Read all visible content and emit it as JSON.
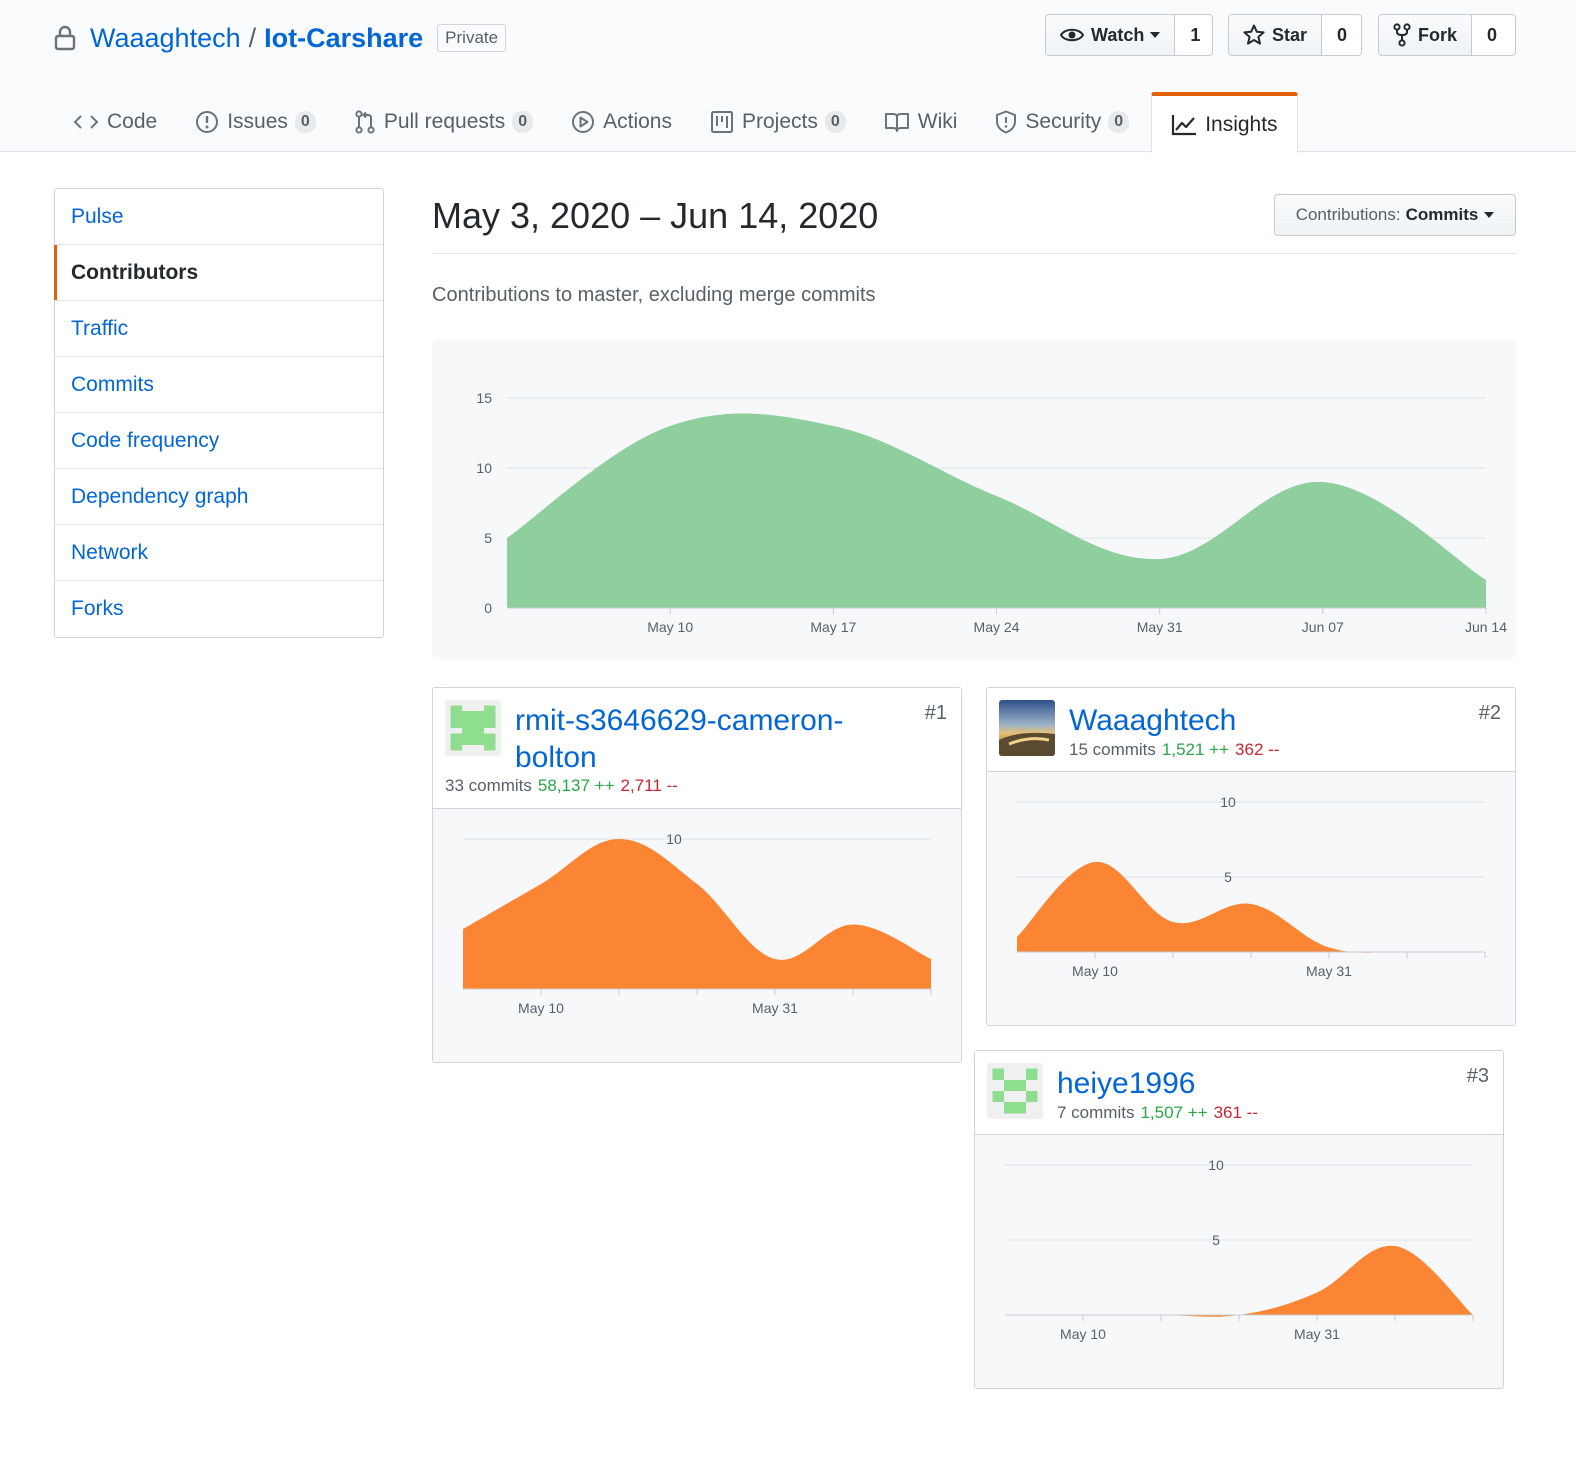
{
  "repo": {
    "owner": "Waaaghtech",
    "separator": "/",
    "name": "Iot-Carshare",
    "visibility": "Private"
  },
  "social": {
    "watch": {
      "label": "Watch",
      "count": "1"
    },
    "star": {
      "label": "Star",
      "count": "0"
    },
    "fork": {
      "label": "Fork",
      "count": "0"
    }
  },
  "nav": [
    {
      "label": "Code",
      "icon": "code-icon",
      "count": null
    },
    {
      "label": "Issues",
      "icon": "issue-icon",
      "count": "0"
    },
    {
      "label": "Pull requests",
      "icon": "pull-request-icon",
      "count": "0"
    },
    {
      "label": "Actions",
      "icon": "play-icon",
      "count": null
    },
    {
      "label": "Projects",
      "icon": "project-icon",
      "count": "0"
    },
    {
      "label": "Wiki",
      "icon": "book-icon",
      "count": null
    },
    {
      "label": "Security",
      "icon": "shield-icon",
      "count": "0"
    },
    {
      "label": "Insights",
      "icon": "graph-icon",
      "count": null,
      "selected": true
    }
  ],
  "sidebar": {
    "items": [
      {
        "label": "Pulse"
      },
      {
        "label": "Contributors",
        "selected": true
      },
      {
        "label": "Traffic"
      },
      {
        "label": "Commits"
      },
      {
        "label": "Code frequency"
      },
      {
        "label": "Dependency graph"
      },
      {
        "label": "Network"
      },
      {
        "label": "Forks"
      }
    ]
  },
  "main": {
    "date_range": "May 3, 2020 – Jun 14, 2020",
    "select_prefix": "Contributions:",
    "select_value": "Commits",
    "subtitle": "Contributions to master, excluding merge commits"
  },
  "colors": {
    "overall": "#8fcf9d",
    "contributor": "#fb8532",
    "link": "#0366d6",
    "accent": "#e36209"
  },
  "chart_data": [
    {
      "id": "overall",
      "type": "area",
      "x": [
        "May 3",
        "May 10",
        "May 17",
        "May 24",
        "May 31",
        "Jun 07",
        "Jun 14"
      ],
      "values": [
        5,
        13,
        13,
        8,
        3.5,
        9,
        2
      ],
      "yticks": [
        0,
        5,
        10,
        15
      ],
      "ylim": [
        0,
        16
      ],
      "xtick_labels": [
        "May 10",
        "May 17",
        "May 24",
        "May 31",
        "Jun 07",
        "Jun 14"
      ],
      "grid": true
    },
    {
      "id": "contributor-1",
      "type": "area",
      "values": [
        4,
        7,
        10,
        7,
        2,
        4.3,
        2
      ],
      "yticks": [
        10
      ],
      "ylim": [
        0,
        10
      ],
      "xtick_labels": [
        "May 10",
        "May 31"
      ]
    },
    {
      "id": "contributor-2",
      "type": "area",
      "values": [
        1,
        6,
        2,
        3.2,
        0.3,
        0,
        0
      ],
      "yticks": [
        5,
        10
      ],
      "ylim": [
        0,
        10
      ],
      "xtick_labels": [
        "May 10",
        "May 31"
      ]
    },
    {
      "id": "contributor-3",
      "type": "area",
      "values": [
        0,
        0,
        0,
        0,
        1.5,
        4.6,
        0
      ],
      "yticks": [
        5,
        10
      ],
      "ylim": [
        0,
        10
      ],
      "xtick_labels": [
        "May 10",
        "May 31"
      ]
    }
  ],
  "contributors": [
    {
      "rank": "#1",
      "name": "rmit-s3646629-cameron-bolton",
      "commits": "33 commits",
      "additions": "58,137 ++",
      "deletions": "2,711 --"
    },
    {
      "rank": "#2",
      "name": "Waaaghtech",
      "commits": "15 commits",
      "additions": "1,521 ++",
      "deletions": "362 --"
    },
    {
      "rank": "#3",
      "name": "heiye1996",
      "commits": "7 commits",
      "additions": "1,507 ++",
      "deletions": "361 --"
    }
  ]
}
